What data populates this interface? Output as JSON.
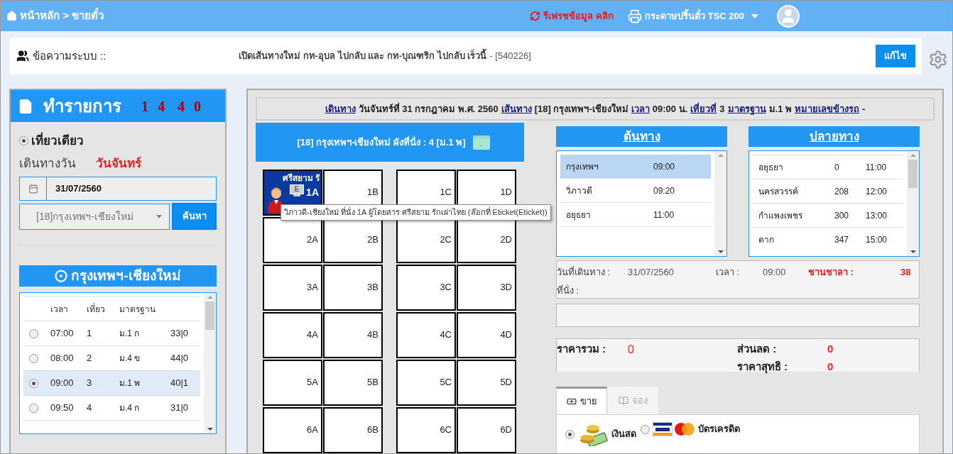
{
  "header": {
    "breadcrumb": "หน้าหลัก > ขายตั๋ว",
    "refresh": "รีเฟรชข้อมูล คลิก",
    "printer": "กระดาษปริ้นตั๋ว TSC 200"
  },
  "message": {
    "label": "ข้อความระบบ ::",
    "text": "เปิดเส้นทางใหม่ กท-อุบล ไปกลับ และ กท-บุณฑริก ไปกลับ เร็วนี้",
    "code": "- [540226]",
    "edit_button": "แก้ไข"
  },
  "left": {
    "title": "ทำรายการ",
    "counters": [
      "1 4",
      "4 0"
    ],
    "trip_type": {
      "label": "เที่ยวเดียว",
      "selected": true
    },
    "date_label": "เดินทางวัน",
    "day": "วันจันทร์",
    "date": "31/07/2560",
    "route_select": "[18]กรุงเทพฯ-เชียงใหม่",
    "search_button": "ค้นหา",
    "route_title": "กรุงเทพฯ-เชียงใหม่",
    "trips": {
      "columns": [
        "เวลา",
        "เที่ยว",
        "มาตรฐาน"
      ],
      "rows": [
        {
          "time": "07:00",
          "trip": "1",
          "standard": "ม.1 ก",
          "seats": "33|0",
          "selected": false
        },
        {
          "time": "08:00",
          "trip": "2",
          "standard": "ม.4 ข",
          "seats": "44|0",
          "selected": false
        },
        {
          "time": "09:00",
          "trip": "3",
          "standard": "ม.1 พ",
          "seats": "40|1",
          "selected": true
        },
        {
          "time": "09:50",
          "trip": "4",
          "standard": "ม.4 ก",
          "seats": "31|0",
          "selected": false
        }
      ]
    }
  },
  "trip_info": [
    {
      "text": "เดินทาง",
      "link": true
    },
    {
      "text": "วันจันทร์ที่ 31 กรกฎาคม พ.ศ. 2560",
      "link": false
    },
    {
      "text": "เส้นทาง",
      "link": true
    },
    {
      "text": "[18] กรุงเทพฯ-เชียงใหม่",
      "link": false
    },
    {
      "text": "เวลา",
      "link": true
    },
    {
      "text": "09:00 น.",
      "link": false
    },
    {
      "text": "เที่ยวที่",
      "link": true
    },
    {
      "text": "3",
      "link": false
    },
    {
      "text": "มาตรฐาน",
      "link": true
    },
    {
      "text": "ม.1 พ",
      "link": false
    },
    {
      "text": "หมายเลขข้างรถ",
      "link": true
    },
    {
      "text": "-",
      "link": false
    }
  ],
  "seat_map": {
    "title": "[18] กรุงเทพฯ-เชียงใหม่ ผังที่นั่ง : 4 [ม.1 พ]",
    "icon_text": "-",
    "rows": [
      [
        {
          "label": "1A",
          "booked": true,
          "passenger": "ศรีสยาม รั",
          "badge": "E"
        },
        {
          "label": "1B",
          "booked": false
        },
        {
          "label": "1C",
          "booked": false
        },
        {
          "label": "1D",
          "booked": false
        }
      ],
      [
        {
          "label": "2A",
          "booked": false
        },
        {
          "label": "2B",
          "booked": false
        },
        {
          "label": "2C",
          "booked": false
        },
        {
          "label": "2D",
          "booked": false
        }
      ],
      [
        {
          "label": "3A",
          "booked": false
        },
        {
          "label": "3B",
          "booked": false
        },
        {
          "label": "3C",
          "booked": false
        },
        {
          "label": "3D",
          "booked": false
        }
      ],
      [
        {
          "label": "4A",
          "booked": false
        },
        {
          "label": "4B",
          "booked": false
        },
        {
          "label": "4C",
          "booked": false
        },
        {
          "label": "4D",
          "booked": false
        }
      ],
      [
        {
          "label": "5A",
          "booked": false
        },
        {
          "label": "5B",
          "booked": false
        },
        {
          "label": "5C",
          "booked": false
        },
        {
          "label": "5D",
          "booked": false
        }
      ],
      [
        {
          "label": "6A",
          "booked": false
        },
        {
          "label": "6B",
          "booked": false
        },
        {
          "label": "6C",
          "booked": false
        },
        {
          "label": "6D",
          "booked": false
        }
      ]
    ],
    "tooltip": "วิภาวดี-เชียงใหม่ ที่นั่ง 1A ผู้โดยสาร ศรีสยาม รักเผ่าไทย (ล๊อกที่  Eticket(Eticket))"
  },
  "origin": {
    "title": "ต้นทาง",
    "items": [
      {
        "name": "กรุงเทพฯ",
        "time": "09:00",
        "selected": true
      },
      {
        "name": "วิภาวดี",
        "time": "09:20",
        "selected": false
      },
      {
        "name": "อยุธยา",
        "time": "11:00",
        "selected": false
      }
    ]
  },
  "destination": {
    "title": "ปลายทาง",
    "items": [
      {
        "name": "อยุธยา",
        "km": "0",
        "time": "11:00"
      },
      {
        "name": "นครสวรรค์",
        "km": "208",
        "time": "12:00"
      },
      {
        "name": "กำแพงเพชร",
        "km": "300",
        "time": "13:00"
      },
      {
        "name": "ตาก",
        "km": "347",
        "time": "15:00"
      }
    ]
  },
  "summary": {
    "date_label": "วันที่เดินทาง :",
    "date": "31/07/2560",
    "time_label": "เวลา :",
    "time": "09:00",
    "platform_label": "ชานชาลา :",
    "platform": "38",
    "seat_label": "ที่นั่ง :"
  },
  "price": {
    "total_label": "ราคารวม :",
    "total": "0",
    "discount_label": "ส่วนลด :",
    "discount": "0",
    "net_label": "ราคาสุทธิ :",
    "net": "0"
  },
  "tabs": [
    {
      "label": "ขาย",
      "selected": true,
      "kind": "sell"
    },
    {
      "label": "จอง",
      "selected": false,
      "kind": "book"
    }
  ],
  "payment": [
    {
      "label": "เงินสด",
      "selected": true,
      "kind": "cash"
    },
    {
      "label": "บัตรเครดิต",
      "selected": false,
      "kind": "card"
    }
  ]
}
